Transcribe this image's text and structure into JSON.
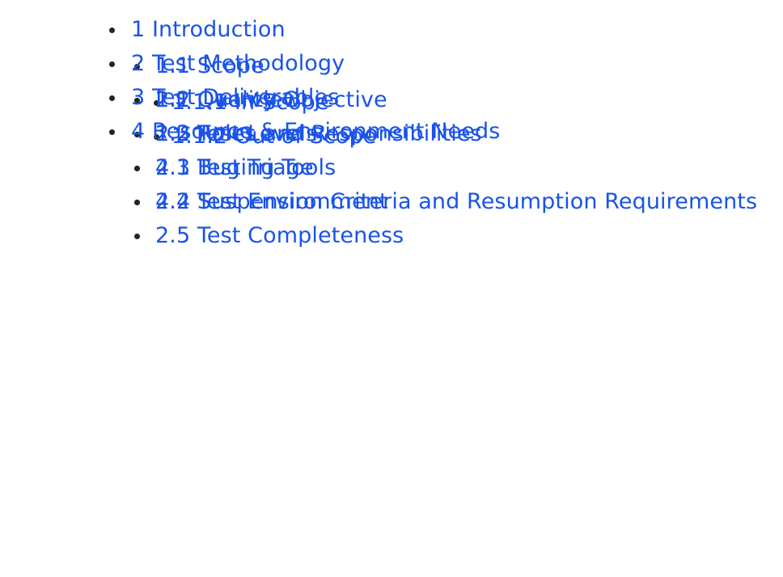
{
  "document": {
    "kind": "table-of-contents",
    "background_color": "#ffffff",
    "link_color": "#1a53e8",
    "bullet_color": "#242424"
  },
  "toc": {
    "items": [
      {
        "label": "1 Introduction",
        "children": [
          {
            "label": "1.1 Scope",
            "children": [
              {
                "label": "1.1.1 In Scope",
                "children": []
              },
              {
                "label": "1.1.2 Out of Scope",
                "children": []
              }
            ]
          },
          {
            "label": "1.2 Quality Objective",
            "children": []
          },
          {
            "label": "1.3 Roles and Responsibilities",
            "children": []
          }
        ]
      },
      {
        "label": "2 Test Methodology",
        "children": [
          {
            "label": "2.1 Overview",
            "children": []
          },
          {
            "label": "2.2 Test Levels",
            "children": []
          },
          {
            "label": "2.3 Bug Triage",
            "children": []
          },
          {
            "label": "2.4 Suspension Criteria and Resumption Requirements",
            "children": []
          },
          {
            "label": "2.5 Test Completeness",
            "children": []
          }
        ]
      },
      {
        "label": "3 Test Deliverables",
        "children": []
      },
      {
        "label": "4 Resource & Environment Needs",
        "children": [
          {
            "label": "4.1 Testing Tools",
            "children": []
          },
          {
            "label": "4.2 Test Environment",
            "children": []
          }
        ]
      }
    ]
  }
}
